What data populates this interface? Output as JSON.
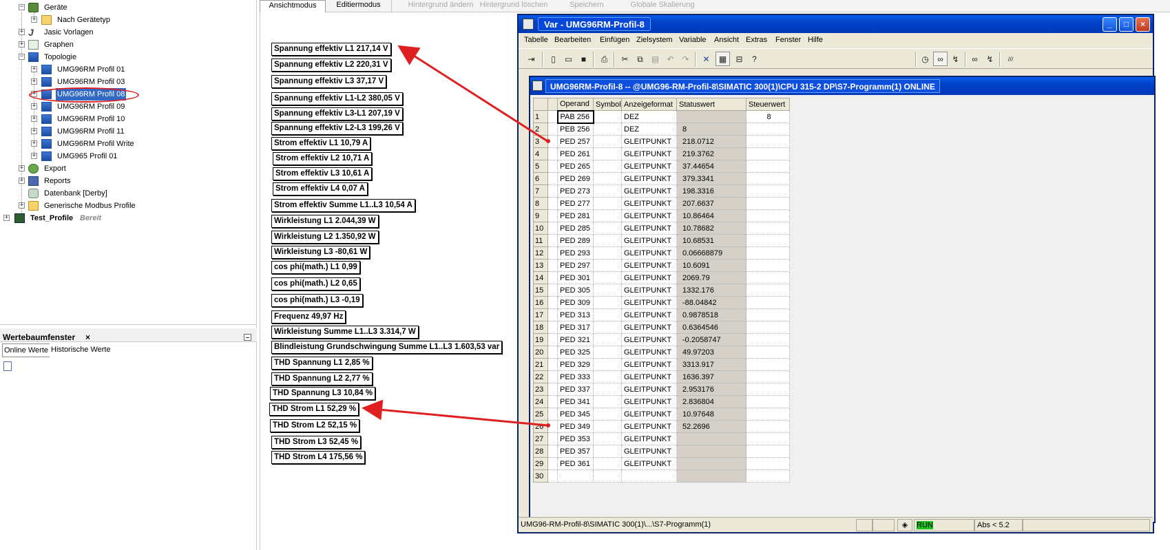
{
  "tree": {
    "items": [
      {
        "label": "Geräte",
        "extra": ""
      },
      {
        "label": "Nach Gerätetyp",
        "extra": ""
      },
      {
        "label": "Jasic Vorlagen",
        "extra": ""
      },
      {
        "label": "Graphen",
        "extra": ""
      },
      {
        "label": "Topologie",
        "extra": ""
      },
      {
        "label": "UMG96RM Profil 01",
        "extra": ""
      },
      {
        "label": "UMG96RM Profil 03",
        "extra": ""
      },
      {
        "label": "UMG96RM Profil 08",
        "extra": ""
      },
      {
        "label": "UMG96RM Profil 09",
        "extra": ""
      },
      {
        "label": "UMG96RM Profil 10",
        "extra": ""
      },
      {
        "label": "UMG96RM Profil 11",
        "extra": ""
      },
      {
        "label": "UMG96RM Profil Write",
        "extra": ""
      },
      {
        "label": "UMG965 Profil 01",
        "extra": ""
      },
      {
        "label": "Export",
        "extra": ""
      },
      {
        "label": "Reports",
        "extra": ""
      },
      {
        "label": "Datenbank [Derby]",
        "extra": ""
      },
      {
        "label": "Generische Modbus Profile",
        "extra": ""
      },
      {
        "label": "Test_Profile",
        "extra": "Bereit"
      }
    ]
  },
  "value_tree": {
    "title": "Wertebaumfenster",
    "close": "×",
    "tabs": [
      "Online Werte",
      "Historische Werte"
    ]
  },
  "mode_bar": {
    "buttons": [
      "Ansichtmodus",
      "Editiermodus",
      "Hintergrund ändern",
      "Hintergrund löschen",
      "Speichern",
      "Globale Skalierung"
    ]
  },
  "values": [
    "Spannung effektiv L1  217,14 V",
    "Spannung effektiv L2  220,31 V",
    "Spannung effektiv L3  37,17 V",
    "Spannung effektiv L1-L2  380,05 V",
    "Spannung effektiv L3-L1  207,19 V",
    "Spannung effektiv L2-L3  199,26 V",
    "Strom effektiv L1  10,79 A",
    "Strom effektiv L2  10,71 A",
    "Strom effektiv L3  10,61 A",
    "Strom effektiv L4  0,07 A",
    "Strom effektiv Summe L1..L3  10,54 A",
    "Wirkleistung L1  2.044,39 W",
    "Wirkleistung L2  1.350,92 W",
    "Wirkleistung L3  -80,61 W",
    "cos phi(math.) L1  0,99",
    "cos phi(math.) L2  0,65",
    "cos phi(math.) L3  -0,19",
    "Frequenz   49,97 Hz",
    "Wirkleistung Summe L1..L3  3.314,7 W",
    "Blindleistung Grundschwingung Summe L1..L3  1.603,53 var",
    "THD Spannung L1  2,85 %",
    "THD Spannung L2  2,77 %",
    "THD Spannung L3  10,84 %",
    "THD Strom L1  52,29 %",
    "THD Strom L2  52,15 %",
    "THD Strom L3  52,45 %",
    "THD Strom L4  175,56 %"
  ],
  "var_window": {
    "title": "Var - UMG96RM-Profil-8",
    "min": "_",
    "max": "□",
    "close": "×",
    "menu": [
      "Tabelle",
      "Bearbeiten",
      "Einfügen",
      "Zielsystem",
      "Variable",
      "Ansicht",
      "Extras",
      "Fenster",
      "Hilfe"
    ],
    "inner_title": "UMG96RM-Profil-8  --  @UMG96-RM-Profil-8\\SIMATIC 300(1)\\CPU 315-2 DP\\S7-Programm(1)  ONLINE",
    "columns": [
      "Operand",
      "Symbol",
      "Anzeigeformat",
      "Statuswert",
      "Steuerwert"
    ],
    "rows": [
      {
        "n": "1",
        "op": "PAB  256",
        "fmt": "DEZ",
        "val": "",
        "ctl": "8"
      },
      {
        "n": "2",
        "op": "PEB  256",
        "fmt": "DEZ",
        "val": "8",
        "ctl": ""
      },
      {
        "n": "3",
        "op": "PED  257",
        "fmt": "GLEITPUNKT",
        "val": "218.0712",
        "ctl": ""
      },
      {
        "n": "4",
        "op": "PED  261",
        "fmt": "GLEITPUNKT",
        "val": "219.3762",
        "ctl": ""
      },
      {
        "n": "5",
        "op": "PED  265",
        "fmt": "GLEITPUNKT",
        "val": "37.44654",
        "ctl": ""
      },
      {
        "n": "6",
        "op": "PED  269",
        "fmt": "GLEITPUNKT",
        "val": "379.3341",
        "ctl": ""
      },
      {
        "n": "7",
        "op": "PED  273",
        "fmt": "GLEITPUNKT",
        "val": "198.3316",
        "ctl": ""
      },
      {
        "n": "8",
        "op": "PED  277",
        "fmt": "GLEITPUNKT",
        "val": "207.6637",
        "ctl": ""
      },
      {
        "n": "9",
        "op": "PED  281",
        "fmt": "GLEITPUNKT",
        "val": "10.86464",
        "ctl": ""
      },
      {
        "n": "10",
        "op": "PED  285",
        "fmt": "GLEITPUNKT",
        "val": "10.78682",
        "ctl": ""
      },
      {
        "n": "11",
        "op": "PED  289",
        "fmt": "GLEITPUNKT",
        "val": "10.68531",
        "ctl": ""
      },
      {
        "n": "12",
        "op": "PED  293",
        "fmt": "GLEITPUNKT",
        "val": "0.06668879",
        "ctl": ""
      },
      {
        "n": "13",
        "op": "PED  297",
        "fmt": "GLEITPUNKT",
        "val": "10.6091",
        "ctl": ""
      },
      {
        "n": "14",
        "op": "PED  301",
        "fmt": "GLEITPUNKT",
        "val": "2069.79",
        "ctl": ""
      },
      {
        "n": "15",
        "op": "PED  305",
        "fmt": "GLEITPUNKT",
        "val": "1332.176",
        "ctl": ""
      },
      {
        "n": "16",
        "op": "PED  309",
        "fmt": "GLEITPUNKT",
        "val": "-88.04842",
        "ctl": ""
      },
      {
        "n": "17",
        "op": "PED  313",
        "fmt": "GLEITPUNKT",
        "val": "0.9878518",
        "ctl": ""
      },
      {
        "n": "18",
        "op": "PED  317",
        "fmt": "GLEITPUNKT",
        "val": "0.6364546",
        "ctl": ""
      },
      {
        "n": "19",
        "op": "PED  321",
        "fmt": "GLEITPUNKT",
        "val": "-0.2058747",
        "ctl": ""
      },
      {
        "n": "20",
        "op": "PED  325",
        "fmt": "GLEITPUNKT",
        "val": "49.97203",
        "ctl": ""
      },
      {
        "n": "21",
        "op": "PED  329",
        "fmt": "GLEITPUNKT",
        "val": "3313.917",
        "ctl": ""
      },
      {
        "n": "22",
        "op": "PED  333",
        "fmt": "GLEITPUNKT",
        "val": "1636.397",
        "ctl": ""
      },
      {
        "n": "23",
        "op": "PED  337",
        "fmt": "GLEITPUNKT",
        "val": "2.953176",
        "ctl": ""
      },
      {
        "n": "24",
        "op": "PED  341",
        "fmt": "GLEITPUNKT",
        "val": "2.836804",
        "ctl": ""
      },
      {
        "n": "25",
        "op": "PED  345",
        "fmt": "GLEITPUNKT",
        "val": "10.97648",
        "ctl": ""
      },
      {
        "n": "26",
        "op": "PED  349",
        "fmt": "GLEITPUNKT",
        "val": "52.2696",
        "ctl": ""
      },
      {
        "n": "27",
        "op": "PED  353",
        "fmt": "GLEITPUNKT",
        "val": "",
        "ctl": ""
      },
      {
        "n": "28",
        "op": "PED  357",
        "fmt": "GLEITPUNKT",
        "val": "",
        "ctl": ""
      },
      {
        "n": "29",
        "op": "PED  361",
        "fmt": "GLEITPUNKT",
        "val": "",
        "ctl": ""
      },
      {
        "n": "30",
        "op": "",
        "fmt": "",
        "val": "",
        "ctl": ""
      }
    ],
    "status_path": "UMG96-RM-Profil-8\\SIMATIC 300(1)\\...\\S7-Programm(1)",
    "run": "RUN",
    "abs": "Abs < 5.2"
  },
  "colors": {
    "accent": "#316ac5",
    "arrow": "#e02020",
    "run": "#1dc21d"
  }
}
